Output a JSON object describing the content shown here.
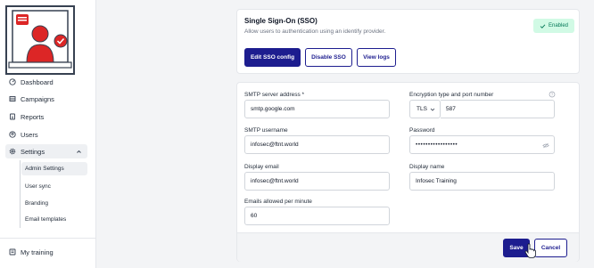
{
  "sidebar": {
    "items": [
      {
        "label": "Dashboard",
        "icon": "dashboard-icon"
      },
      {
        "label": "Campaigns",
        "icon": "campaigns-icon"
      },
      {
        "label": "Reports",
        "icon": "reports-icon"
      },
      {
        "label": "Users",
        "icon": "users-icon"
      },
      {
        "label": "Settings",
        "icon": "gear-icon"
      }
    ],
    "settings_sub": [
      {
        "label": "Admin Settings"
      },
      {
        "label": "User sync"
      },
      {
        "label": "Branding"
      },
      {
        "label": "Email templates"
      }
    ],
    "bottom_items": [
      {
        "label": "My training",
        "icon": "training-icon"
      }
    ]
  },
  "sso": {
    "title": "Single Sign-On (SSO)",
    "subtitle": "Allow users to authentication using an identify provider.",
    "badge": "Enabled",
    "buttons": {
      "edit": "Edit SSO config",
      "disable": "Disable SSO",
      "logs": "View logs"
    }
  },
  "smtp": {
    "server_label": "SMTP server address *",
    "server_value": "smtp.google.com",
    "encryption_label": "Encryption type and port number",
    "encryption_value": "TLS",
    "port_value": "587",
    "username_label": "SMTP username",
    "username_value": "infosec@ftnt.world",
    "password_label": "Password",
    "password_value": "•••••••••••••••••",
    "display_email_label": "Display email",
    "display_email_value": "infosec@ftnt.world",
    "display_name_label": "Display name",
    "display_name_value": "Infosec Training",
    "rate_label": "Emails allowed per minute",
    "rate_value": "60"
  },
  "footer": {
    "save": "Save",
    "cancel": "Cancel"
  },
  "colors": {
    "primary": "#1d1d8f",
    "badge_bg": "#d1fae5",
    "badge_text": "#047857",
    "logo_red": "#dc2626"
  }
}
